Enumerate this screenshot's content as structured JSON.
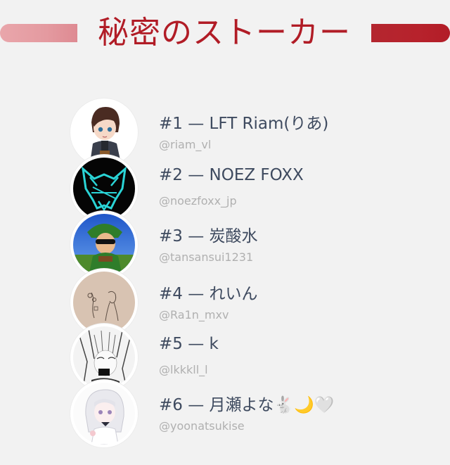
{
  "title": "秘密のストーカー",
  "colors": {
    "title": "#b11c26",
    "background": "#f2f2f2",
    "name_text": "#3e4a5f",
    "handle_text": "#b0b0b0"
  },
  "entries": [
    {
      "label": "#1 — LFT Riam(りあ)",
      "handle": "@riam_vl",
      "avatar_icon": "anime-boy-avatar"
    },
    {
      "label": "#2 — NOEZ FOXX",
      "handle": "@noezfoxx_jp",
      "avatar_icon": "fox-logo-avatar"
    },
    {
      "label": "#3 — 炭酸水",
      "handle": "@tansansui1231",
      "avatar_icon": "sunglasses-character-avatar"
    },
    {
      "label": "#4 — れいん",
      "handle": "@Ra1n_mxv",
      "avatar_icon": "sketch-drawing-avatar"
    },
    {
      "label": "#5 — k",
      "handle": "@lkkkll_l",
      "avatar_icon": "manga-face-avatar"
    },
    {
      "label": "#6 — 月瀬よな🐇🌙🤍",
      "handle": "@yoonatsukise",
      "avatar_icon": "white-hair-anime-avatar"
    }
  ]
}
